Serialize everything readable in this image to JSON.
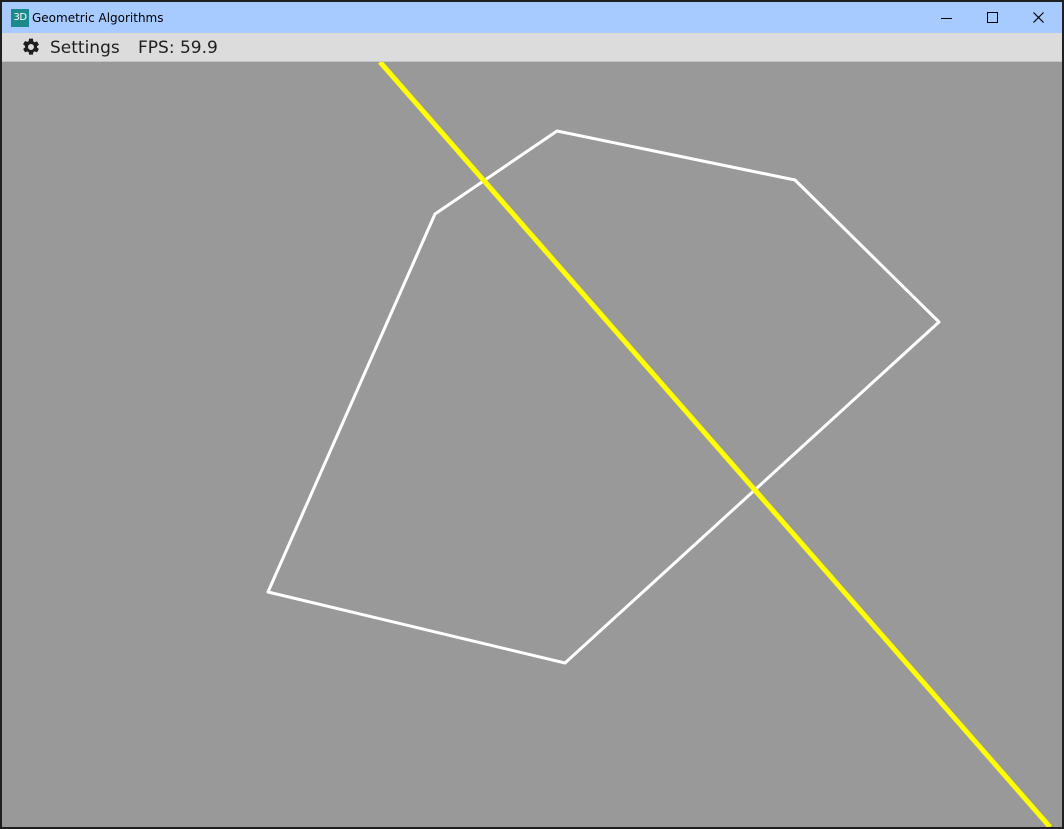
{
  "window": {
    "icon_text": "3D",
    "title": "Geometric Algorithms"
  },
  "menubar": {
    "settings_label": "Settings",
    "fps_text": "FPS: 59.9"
  },
  "scene": {
    "background": "#999999",
    "polygon_color": "#ffffff",
    "line_color": "#ffff00",
    "icons": {
      "settings": "gear-icon",
      "minimize": "minimize-icon",
      "maximize": "maximize-icon",
      "close": "close-icon"
    }
  }
}
